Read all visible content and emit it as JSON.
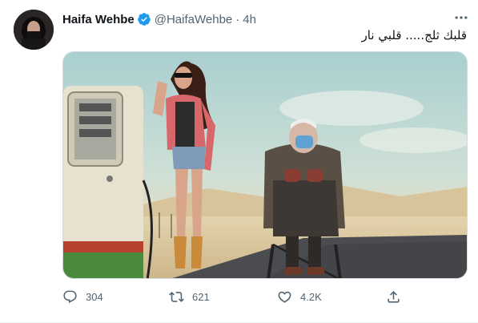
{
  "tweet": {
    "author": {
      "display_name": "Haifa Wehbe",
      "handle": "@HaifaWehbe",
      "verified": true
    },
    "separator": "·",
    "time": "4h",
    "text": "قلبك ثلج..... قلبي نار",
    "actions": {
      "reply_count": "304",
      "retweet_count": "621",
      "like_count": "4.2K"
    }
  },
  "icons": {
    "more": "more-icon",
    "verified": "verified-badge-icon",
    "reply": "reply-icon",
    "retweet": "retweet-icon",
    "like": "heart-icon",
    "share": "share-icon"
  },
  "colors": {
    "accent": "#1d9bf0",
    "text_primary": "#0f1419",
    "text_secondary": "#536471"
  }
}
